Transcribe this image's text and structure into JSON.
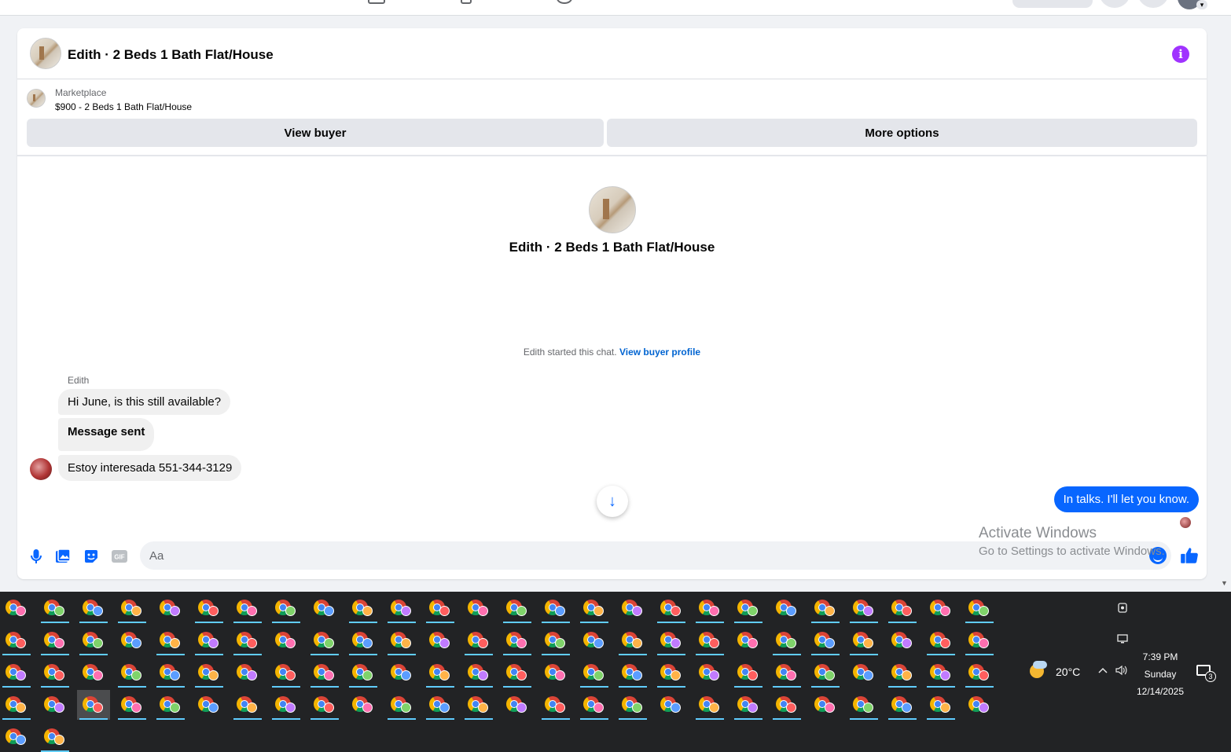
{
  "header": {
    "title": "Edith · 2 Beds 1 Bath Flat/House"
  },
  "listing": {
    "label": "Marketplace",
    "price_title": "$900 - 2 Beds 1 Bath Flat/House",
    "view_buyer_label": "View buyer",
    "more_options_label": "More options"
  },
  "conversation": {
    "hero_title": "Edith · 2 Beds 1 Bath Flat/House",
    "started_text": "Edith started this chat.",
    "view_buyer_profile_link": "View buyer profile",
    "sender_name": "Edith",
    "messages": [
      {
        "text": "Hi June, is this still available?",
        "direction": "incoming"
      },
      {
        "text": "Message sent",
        "direction": "incoming"
      },
      {
        "text": "Estoy interesada 551-344-3129",
        "direction": "incoming"
      },
      {
        "text": "In talks. I'll let you know.",
        "direction": "outgoing"
      }
    ]
  },
  "composer": {
    "placeholder": "Aa",
    "icons": [
      "mic-icon",
      "photo-icon",
      "sticker-icon",
      "gif-icon",
      "emoji-icon",
      "thumbs-up-icon"
    ],
    "gif_label": "GIF"
  },
  "watermark": {
    "line1": "Activate Windows",
    "line2": "Go to Settings to activate Windows."
  },
  "taskbar": {
    "weather_temp": "20°C",
    "time": "7:39 PM",
    "day": "Sunday",
    "date": "12/14/2025",
    "notification_count": "3"
  },
  "colors": {
    "accent": "#0866ff",
    "info_purple": "#a033ff",
    "taskbar_bg": "#222325",
    "active_underline": "#60cdff"
  }
}
